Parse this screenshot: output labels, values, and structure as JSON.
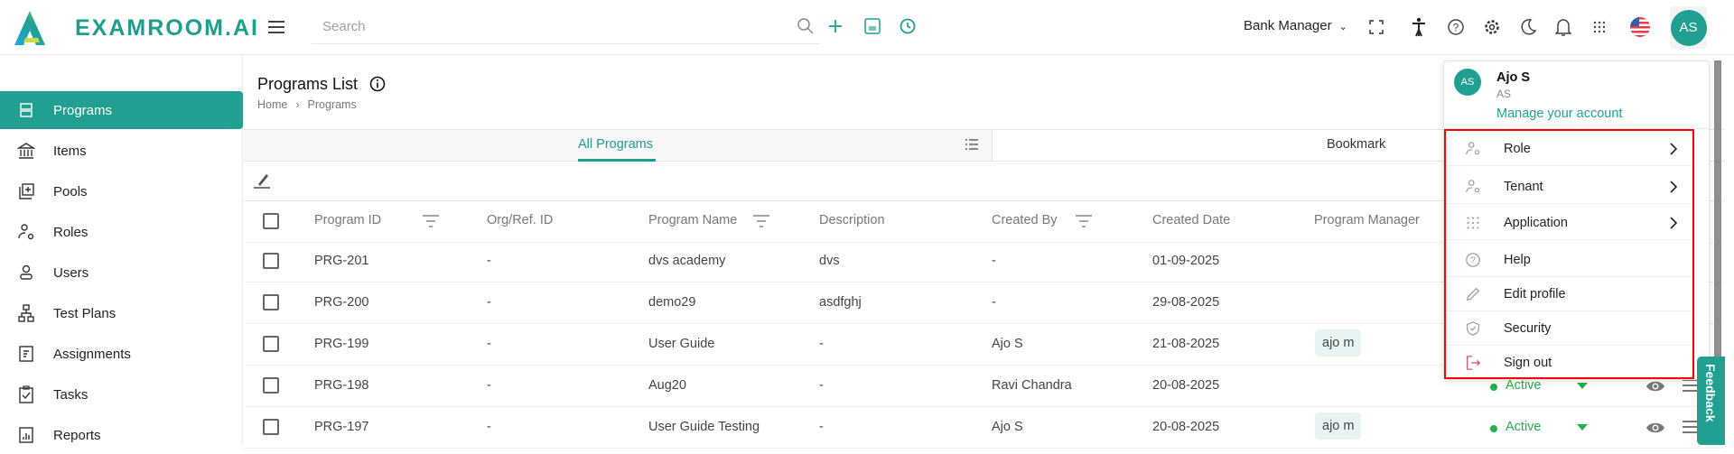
{
  "app": {
    "logo_text": "EXAMROOM.AI"
  },
  "header": {
    "search_placeholder": "Search",
    "role_select": "Bank Manager",
    "avatar_initials": "AS"
  },
  "sidebar": {
    "items": [
      {
        "label": "Programs",
        "icon": "server-icon",
        "active": true
      },
      {
        "label": "Items",
        "icon": "bank-icon"
      },
      {
        "label": "Pools",
        "icon": "library-add-icon"
      },
      {
        "label": "Roles",
        "icon": "user-gear-icon"
      },
      {
        "label": "Users",
        "icon": "user-icon"
      },
      {
        "label": "Test Plans",
        "icon": "sitemap-icon"
      },
      {
        "label": "Assignments",
        "icon": "document-icon"
      },
      {
        "label": "Tasks",
        "icon": "clipboard-check-icon"
      },
      {
        "label": "Reports",
        "icon": "report-icon"
      }
    ]
  },
  "page": {
    "title": "Programs List",
    "breadcrumb": [
      "Home",
      "Programs"
    ]
  },
  "tabs": [
    {
      "label": "All Programs",
      "active": true
    },
    {
      "label": "Bookmark"
    }
  ],
  "table": {
    "columns": [
      "Program ID",
      "Org/Ref. ID",
      "Program Name",
      "Description",
      "Created By",
      "Created Date",
      "Program Manager"
    ],
    "rows": [
      {
        "id": "PRG-201",
        "org": "-",
        "name": "dvs academy",
        "desc": "dvs",
        "created_by": "-",
        "date": "01-09-2025",
        "manager": ""
      },
      {
        "id": "PRG-200",
        "org": "-",
        "name": "demo29",
        "desc": "asdfghj",
        "created_by": "-",
        "date": "29-08-2025",
        "manager": ""
      },
      {
        "id": "PRG-199",
        "org": "-",
        "name": "User Guide",
        "desc": "-",
        "created_by": "Ajo S",
        "date": "21-08-2025",
        "manager": "ajo m"
      },
      {
        "id": "PRG-198",
        "org": "-",
        "name": "Aug20",
        "desc": "-",
        "created_by": "Ravi Chandra",
        "date": "20-08-2025",
        "manager": "",
        "status": "Active"
      },
      {
        "id": "PRG-197",
        "org": "-",
        "name": "User Guide Testing",
        "desc": "-",
        "created_by": "Ajo S",
        "date": "20-08-2025",
        "manager": "ajo m",
        "status": "Active"
      }
    ]
  },
  "profile_menu": {
    "name": "Ajo S",
    "initials": "AS",
    "manage_link": "Manage your account",
    "items": [
      {
        "label": "Role",
        "submenu": true
      },
      {
        "label": "Tenant",
        "submenu": true
      },
      {
        "label": "Application",
        "submenu": true
      },
      {
        "label": "Help"
      },
      {
        "label": "Edit profile"
      },
      {
        "label": "Security"
      },
      {
        "label": "Sign out"
      }
    ]
  },
  "feedback": "Feedback",
  "colors": {
    "brand": "#21a091",
    "active": "#22b14c",
    "signout": "#e0455a",
    "highlight": "#ff0000"
  }
}
